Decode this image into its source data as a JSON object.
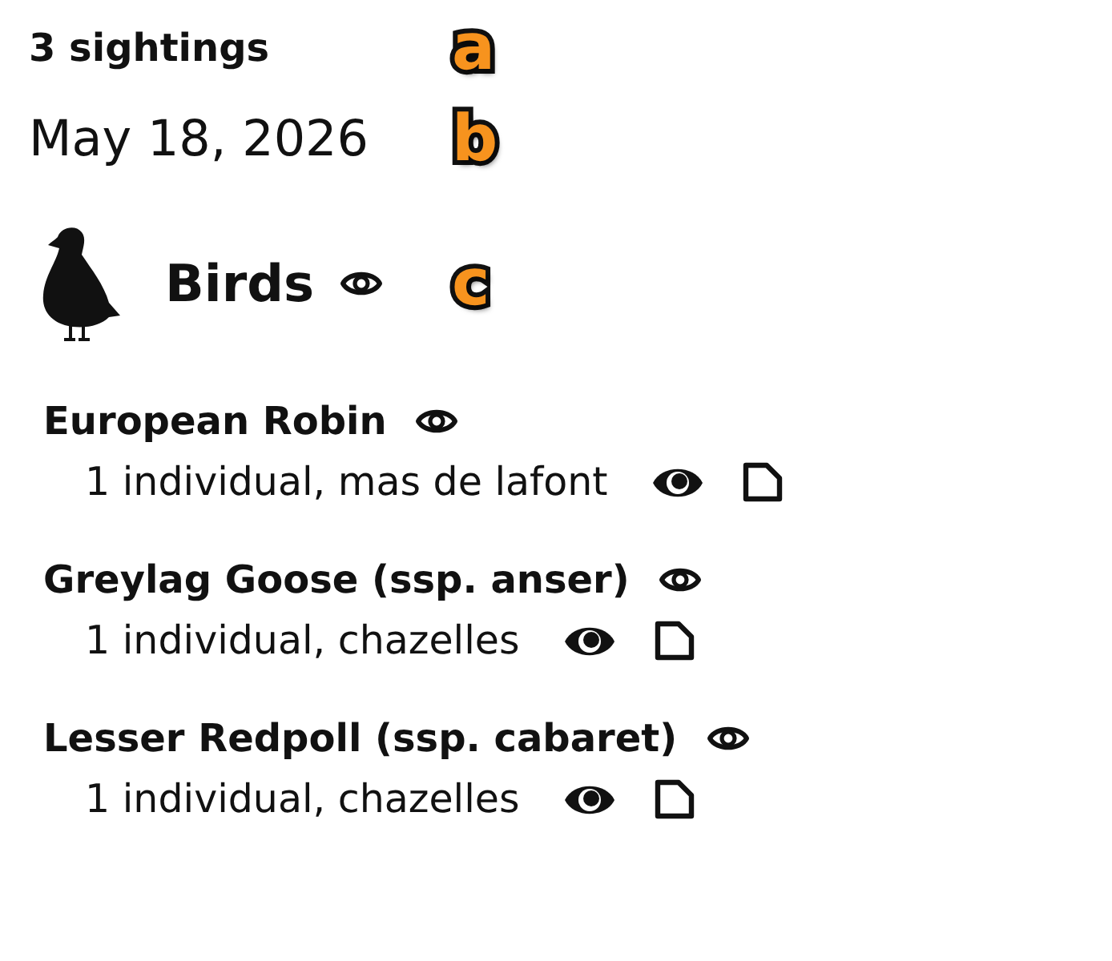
{
  "summary": {
    "count": "3 sightings",
    "callout": "a"
  },
  "date": {
    "text": "May 18, 2026",
    "callout": "b"
  },
  "group": {
    "name": "Birds",
    "callout": "c"
  },
  "species": [
    {
      "name": "European Robin",
      "detail": "1 individual, mas de lafont"
    },
    {
      "name": "Greylag Goose (ssp. anser)",
      "detail": "1 individual, chazelles"
    },
    {
      "name": "Lesser Redpoll (ssp. cabaret)",
      "detail": "1 individual, chazelles"
    }
  ]
}
